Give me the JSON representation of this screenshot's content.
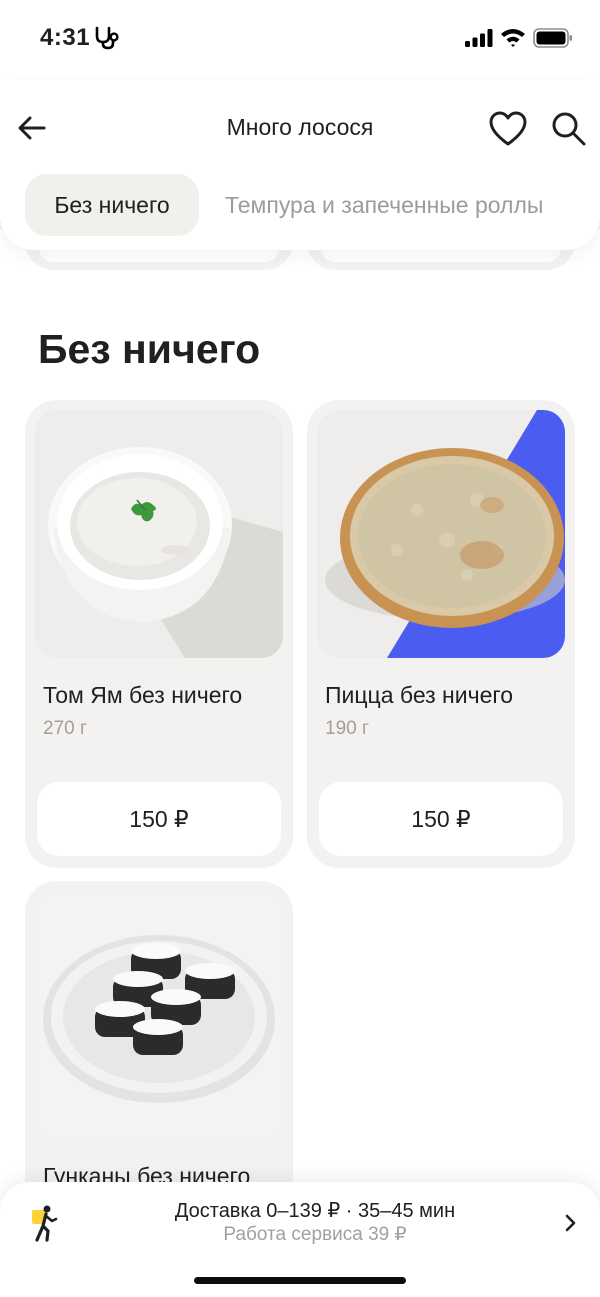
{
  "status_bar": {
    "time": "4:31",
    "icons": [
      "health-icon",
      "signal-icon",
      "wifi-icon",
      "battery-icon"
    ]
  },
  "header": {
    "title": "Много лосося",
    "icons": [
      "back-arrow-icon",
      "heart-icon",
      "search-icon"
    ]
  },
  "categories": [
    {
      "label": "Без ничего",
      "active": true
    },
    {
      "label": "Темпура и запеченные роллы",
      "active": false
    }
  ],
  "section": {
    "title": "Без ничего",
    "products": [
      {
        "name": "Том Ям без ничего",
        "weight": "270 г",
        "price": "150 ₽",
        "image_icon": "soup-bowl-icon"
      },
      {
        "name": "Пицца без ничего",
        "weight": "190 г",
        "price": "150 ₽",
        "image_icon": "pizza-icon"
      },
      {
        "name": "Гунканы без ничего",
        "image_icon": "gunkan-plate-icon"
      }
    ]
  },
  "delivery": {
    "main": "Доставка 0–139 ₽ · 35–45 мин",
    "sub": "Работа сервиса 39 ₽",
    "icon": "courier-icon"
  },
  "colors": {
    "accent_blue": "#4a5df0",
    "card_bg": "#f3f2f0",
    "muted_text": "#a3a09c"
  }
}
